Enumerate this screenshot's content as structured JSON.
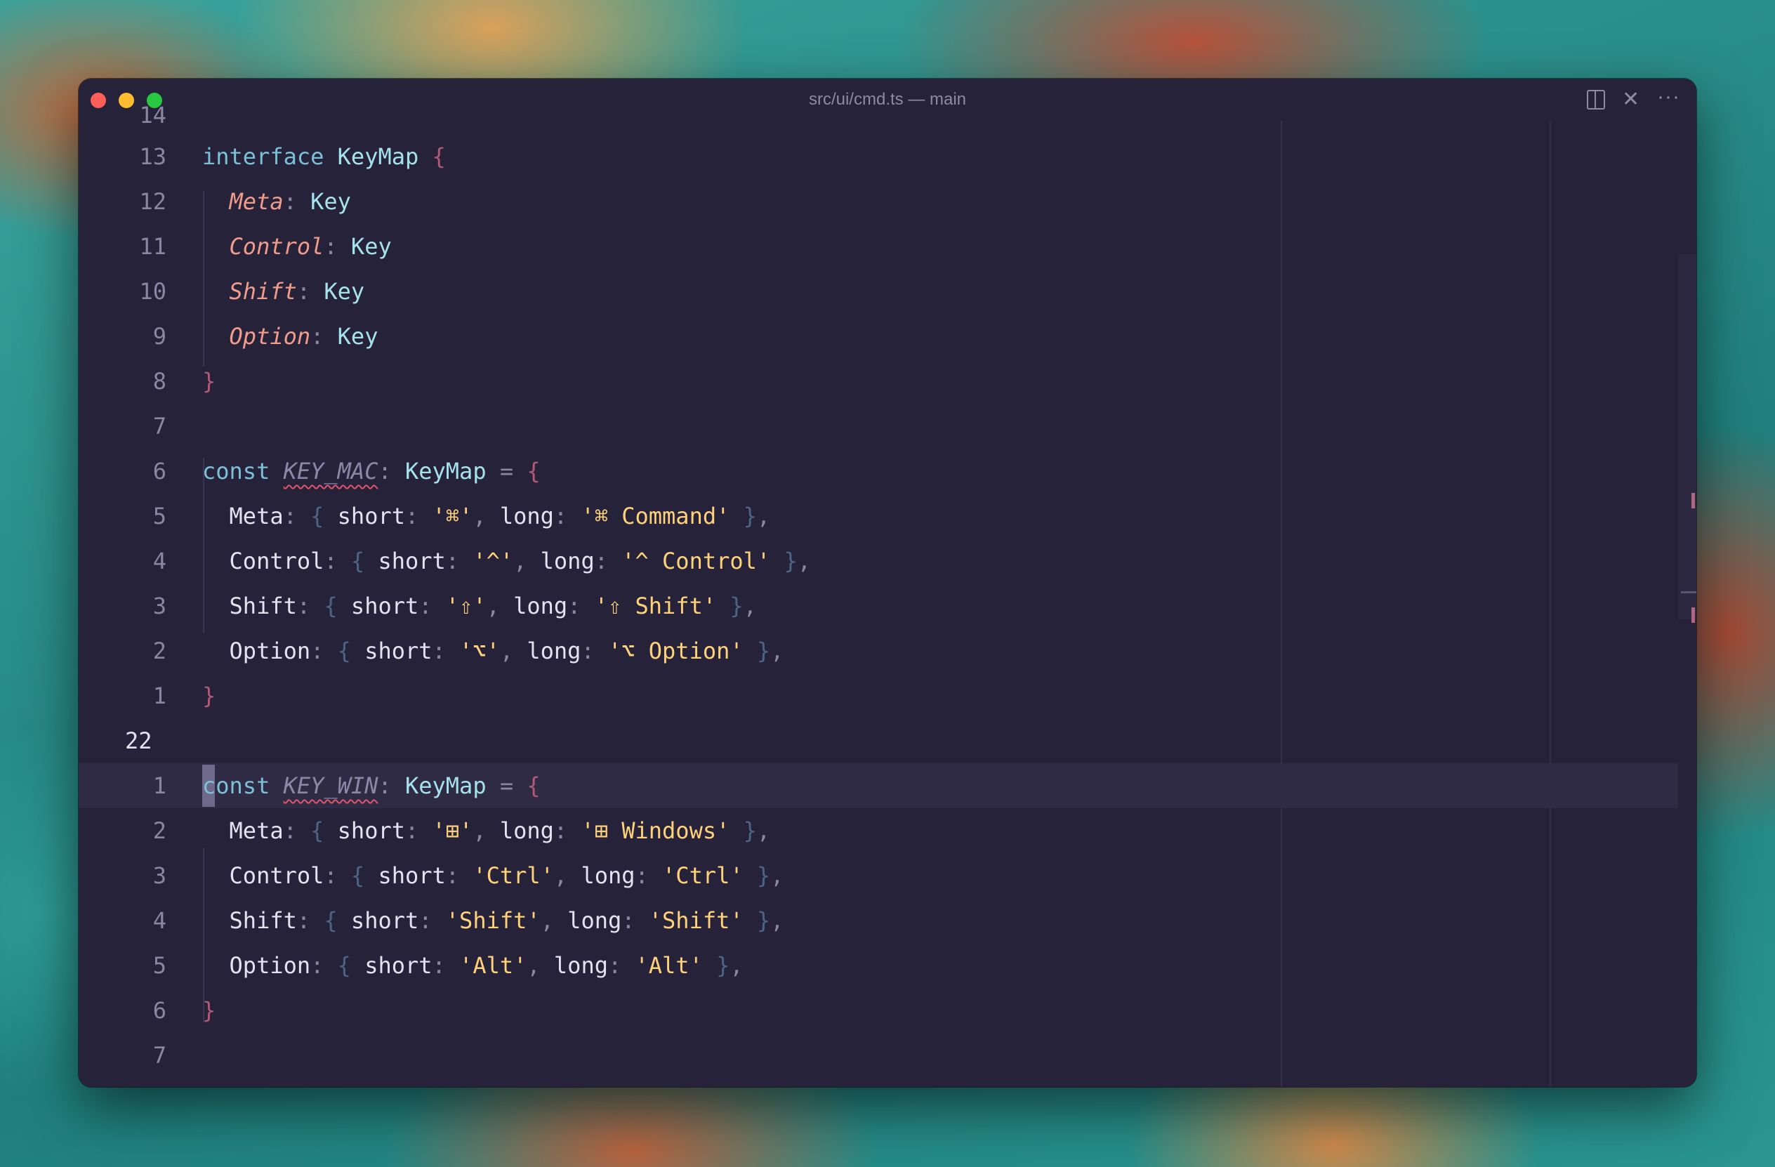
{
  "window": {
    "title": "src/ui/cmd.ts — main"
  },
  "toolbar": {
    "split_icon": "split-editor-icon",
    "close_icon": "close-icon",
    "more_icon": "more-icon",
    "close_glyph": "✕",
    "more_glyph": "···"
  },
  "colors": {
    "keyword": "#7cc0d8",
    "type": "#a6e2ed",
    "property": "#ef9c8b",
    "string": "#ffd27a",
    "brace": "#b15a76",
    "inner_brace": "#4c6585",
    "background": "#26223a",
    "line_number": "#8a86a3"
  },
  "editor": {
    "clipped_top_line_number": "14",
    "current_line_number": "22",
    "lines": [
      {
        "n": "13",
        "t": [
          [
            "kw",
            "interface"
          ],
          [
            "plain",
            " "
          ],
          [
            "ty",
            "KeyMap"
          ],
          [
            "plain",
            " "
          ],
          [
            "brace",
            "{"
          ]
        ]
      },
      {
        "n": "12",
        "t": [
          [
            "plain",
            "  "
          ],
          [
            "prop",
            "Meta"
          ],
          [
            "pun",
            ":"
          ],
          [
            "plain",
            " "
          ],
          [
            "ty",
            "Key"
          ]
        ]
      },
      {
        "n": "11",
        "t": [
          [
            "plain",
            "  "
          ],
          [
            "prop",
            "Control"
          ],
          [
            "pun",
            ":"
          ],
          [
            "plain",
            " "
          ],
          [
            "ty",
            "Key"
          ]
        ]
      },
      {
        "n": "10",
        "t": [
          [
            "plain",
            "  "
          ],
          [
            "prop",
            "Shift"
          ],
          [
            "pun",
            ":"
          ],
          [
            "plain",
            " "
          ],
          [
            "ty",
            "Key"
          ]
        ]
      },
      {
        "n": "9",
        "t": [
          [
            "plain",
            "  "
          ],
          [
            "prop",
            "Option"
          ],
          [
            "pun",
            ":"
          ],
          [
            "plain",
            " "
          ],
          [
            "ty",
            "Key"
          ]
        ]
      },
      {
        "n": "8",
        "t": [
          [
            "brace",
            "}"
          ]
        ]
      },
      {
        "n": "7",
        "t": []
      },
      {
        "n": "6",
        "t": [
          [
            "kw",
            "const"
          ],
          [
            "plain",
            " "
          ],
          [
            "cname",
            "KEY_MAC"
          ],
          [
            "pun",
            ":"
          ],
          [
            "plain",
            " "
          ],
          [
            "ty",
            "KeyMap"
          ],
          [
            "plain",
            " "
          ],
          [
            "pun",
            "="
          ],
          [
            "plain",
            " "
          ],
          [
            "brace",
            "{"
          ]
        ]
      },
      {
        "n": "5",
        "t": [
          [
            "plain",
            "  Meta"
          ],
          [
            "pun",
            ":"
          ],
          [
            "plain",
            " "
          ],
          [
            "ibrace",
            "{"
          ],
          [
            "plain",
            " short"
          ],
          [
            "pun",
            ":"
          ],
          [
            "plain",
            " "
          ],
          [
            "str",
            "'⌘'"
          ],
          [
            "pun",
            ","
          ],
          [
            "plain",
            " long"
          ],
          [
            "pun",
            ":"
          ],
          [
            "plain",
            " "
          ],
          [
            "str",
            "'⌘ Command'"
          ],
          [
            "plain",
            " "
          ],
          [
            "ibrace",
            "}"
          ],
          [
            "pun",
            ","
          ]
        ]
      },
      {
        "n": "4",
        "t": [
          [
            "plain",
            "  Control"
          ],
          [
            "pun",
            ":"
          ],
          [
            "plain",
            " "
          ],
          [
            "ibrace",
            "{"
          ],
          [
            "plain",
            " short"
          ],
          [
            "pun",
            ":"
          ],
          [
            "plain",
            " "
          ],
          [
            "str",
            "'^'"
          ],
          [
            "pun",
            ","
          ],
          [
            "plain",
            " long"
          ],
          [
            "pun",
            ":"
          ],
          [
            "plain",
            " "
          ],
          [
            "str",
            "'^ Control'"
          ],
          [
            "plain",
            " "
          ],
          [
            "ibrace",
            "}"
          ],
          [
            "pun",
            ","
          ]
        ]
      },
      {
        "n": "3",
        "t": [
          [
            "plain",
            "  Shift"
          ],
          [
            "pun",
            ":"
          ],
          [
            "plain",
            " "
          ],
          [
            "ibrace",
            "{"
          ],
          [
            "plain",
            " short"
          ],
          [
            "pun",
            ":"
          ],
          [
            "plain",
            " "
          ],
          [
            "str",
            "'⇧'"
          ],
          [
            "pun",
            ","
          ],
          [
            "plain",
            " long"
          ],
          [
            "pun",
            ":"
          ],
          [
            "plain",
            " "
          ],
          [
            "str",
            "'⇧ Shift'"
          ],
          [
            "plain",
            " "
          ],
          [
            "ibrace",
            "}"
          ],
          [
            "pun",
            ","
          ]
        ]
      },
      {
        "n": "2",
        "t": [
          [
            "plain",
            "  Option"
          ],
          [
            "pun",
            ":"
          ],
          [
            "plain",
            " "
          ],
          [
            "ibrace",
            "{"
          ],
          [
            "plain",
            " short"
          ],
          [
            "pun",
            ":"
          ],
          [
            "plain",
            " "
          ],
          [
            "str",
            "'⌥'"
          ],
          [
            "pun",
            ","
          ],
          [
            "plain",
            " long"
          ],
          [
            "pun",
            ":"
          ],
          [
            "plain",
            " "
          ],
          [
            "str",
            "'⌥ Option'"
          ],
          [
            "plain",
            " "
          ],
          [
            "ibrace",
            "}"
          ],
          [
            "pun",
            ","
          ]
        ]
      },
      {
        "n": "1",
        "t": [
          [
            "brace",
            "}"
          ]
        ]
      },
      {
        "n": "22",
        "t": [],
        "current": true
      },
      {
        "n": "1",
        "t": [
          [
            "kw",
            "const"
          ],
          [
            "plain",
            " "
          ],
          [
            "cname",
            "KEY_WIN"
          ],
          [
            "pun",
            ":"
          ],
          [
            "plain",
            " "
          ],
          [
            "ty",
            "KeyMap"
          ],
          [
            "plain",
            " "
          ],
          [
            "pun",
            "="
          ],
          [
            "plain",
            " "
          ],
          [
            "brace",
            "{"
          ]
        ]
      },
      {
        "n": "2",
        "t": [
          [
            "plain",
            "  Meta"
          ],
          [
            "pun",
            ":"
          ],
          [
            "plain",
            " "
          ],
          [
            "ibrace",
            "{"
          ],
          [
            "plain",
            " short"
          ],
          [
            "pun",
            ":"
          ],
          [
            "plain",
            " "
          ],
          [
            "str",
            "'⊞'"
          ],
          [
            "pun",
            ","
          ],
          [
            "plain",
            " long"
          ],
          [
            "pun",
            ":"
          ],
          [
            "plain",
            " "
          ],
          [
            "str",
            "'⊞ Windows'"
          ],
          [
            "plain",
            " "
          ],
          [
            "ibrace",
            "}"
          ],
          [
            "pun",
            ","
          ]
        ]
      },
      {
        "n": "3",
        "t": [
          [
            "plain",
            "  Control"
          ],
          [
            "pun",
            ":"
          ],
          [
            "plain",
            " "
          ],
          [
            "ibrace",
            "{"
          ],
          [
            "plain",
            " short"
          ],
          [
            "pun",
            ":"
          ],
          [
            "plain",
            " "
          ],
          [
            "str",
            "'Ctrl'"
          ],
          [
            "pun",
            ","
          ],
          [
            "plain",
            " long"
          ],
          [
            "pun",
            ":"
          ],
          [
            "plain",
            " "
          ],
          [
            "str",
            "'Ctrl'"
          ],
          [
            "plain",
            " "
          ],
          [
            "ibrace",
            "}"
          ],
          [
            "pun",
            ","
          ]
        ]
      },
      {
        "n": "4",
        "t": [
          [
            "plain",
            "  Shift"
          ],
          [
            "pun",
            ":"
          ],
          [
            "plain",
            " "
          ],
          [
            "ibrace",
            "{"
          ],
          [
            "plain",
            " short"
          ],
          [
            "pun",
            ":"
          ],
          [
            "plain",
            " "
          ],
          [
            "str",
            "'Shift'"
          ],
          [
            "pun",
            ","
          ],
          [
            "plain",
            " long"
          ],
          [
            "pun",
            ":"
          ],
          [
            "plain",
            " "
          ],
          [
            "str",
            "'Shift'"
          ],
          [
            "plain",
            " "
          ],
          [
            "ibrace",
            "}"
          ],
          [
            "pun",
            ","
          ]
        ]
      },
      {
        "n": "5",
        "t": [
          [
            "plain",
            "  Option"
          ],
          [
            "pun",
            ":"
          ],
          [
            "plain",
            " "
          ],
          [
            "ibrace",
            "{"
          ],
          [
            "plain",
            " short"
          ],
          [
            "pun",
            ":"
          ],
          [
            "plain",
            " "
          ],
          [
            "str",
            "'Alt'"
          ],
          [
            "pun",
            ","
          ],
          [
            "plain",
            " long"
          ],
          [
            "pun",
            ":"
          ],
          [
            "plain",
            " "
          ],
          [
            "str",
            "'Alt'"
          ],
          [
            "plain",
            " "
          ],
          [
            "ibrace",
            "}"
          ],
          [
            "pun",
            ","
          ]
        ]
      },
      {
        "n": "6",
        "t": [
          [
            "brace",
            "}"
          ]
        ]
      },
      {
        "n": "7",
        "t": []
      }
    ]
  }
}
